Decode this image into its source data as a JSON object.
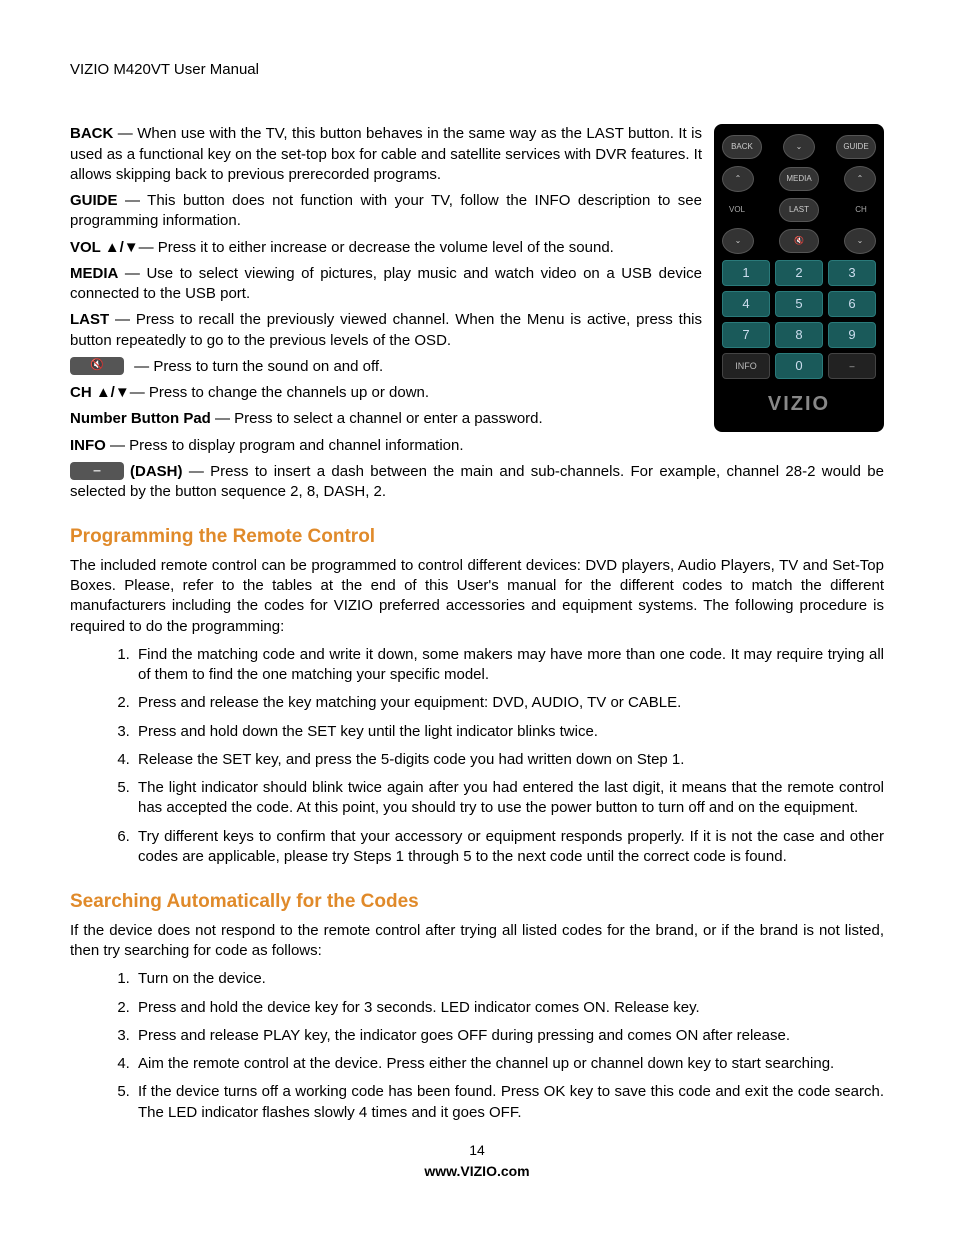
{
  "header": "VIZIO M420VT User Manual",
  "definitions": [
    {
      "key": "BACK",
      "text": " — When use with the TV, this button behaves in the same way as the LAST button. It is used as a functional key on the set-top box for cable and satellite services with DVR features. It allows skipping back to previous prerecorded programs."
    },
    {
      "key": "GUIDE",
      "text": " — This button does not function with your TV, follow the INFO description to see programming information."
    },
    {
      "key": "VOL ▲/▼",
      "text": "— Press it to either increase or decrease the volume level of the sound."
    },
    {
      "key": "MEDIA",
      "text": " — Use to select viewing of pictures, play music and watch video on a USB device connected to the USB port."
    },
    {
      "key": "LAST",
      "text": " — Press to recall the previously viewed channel. When the Menu is active, press this button repeatedly to go to the previous levels of the OSD."
    }
  ],
  "mute_text": " —  Press to turn the sound on and off.",
  "ch": {
    "key": "CH ▲/▼",
    "text": "— Press to change the channels up or down."
  },
  "numpad": {
    "key": "Number Button Pad",
    "text": " — Press to select a channel or enter a password."
  },
  "info": {
    "key": "INFO",
    "text": " — Press to display program and channel information."
  },
  "dash": {
    "key": "(DASH)",
    "text": " — Press to insert a dash between the main and sub-channels. For example, channel 28-2 would be selected by the button sequence 2, 8, DASH, 2."
  },
  "section1": {
    "title": "Programming the Remote Control",
    "intro": "The included remote control can be programmed to control different devices: DVD players, Audio Players, TV and Set-Top Boxes. Please, refer to the tables at the end of this User's manual for the different codes to match the different manufacturers including the codes for VIZIO preferred accessories and equipment systems. The following procedure is required to do the programming:",
    "steps": [
      "Find the matching code and write it down, some makers may have more than one code. It may require trying all of them to find the one matching your specific model.",
      "Press and release the key matching your equipment: DVD, AUDIO, TV or CABLE.",
      "Press and hold down the SET key until the light indicator blinks twice.",
      "Release the SET key, and press the 5-digits code you had written down on Step 1.",
      "The light indicator should blink twice again after you had entered the last digit, it means that the remote control has accepted the code. At this point, you should try to use the power button to turn off and on the equipment.",
      "Try different keys to confirm that your accessory or equipment responds properly. If it is not the case and other codes are applicable, please try Steps 1 through 5 to the next code until the correct code is found."
    ]
  },
  "section2": {
    "title": "Searching Automatically for the Codes",
    "intro": "If the device does not respond to the remote control after trying all listed codes for the brand, or if the brand is not listed, then try searching for code as follows:",
    "steps": [
      "Turn on the device.",
      "Press and hold the device key for 3 seconds. LED indicator comes ON. Release key.",
      "Press and release PLAY key, the indicator goes OFF during pressing and comes ON after release.",
      "Aim the remote control at the device. Press either the channel up or channel down key to start searching.",
      "If the device turns off a working code has been found. Press OK key to save this code and exit the code search. The LED indicator flashes slowly 4 times and it goes OFF."
    ]
  },
  "remote": {
    "back": "BACK",
    "guide": "GUIDE",
    "media": "MEDIA",
    "last": "LAST",
    "vol": "VOL",
    "ch": "CH",
    "info": "INFO",
    "keys": [
      "1",
      "2",
      "3",
      "4",
      "5",
      "6",
      "7",
      "8",
      "9"
    ],
    "zero": "0",
    "dash": "–",
    "logo": "VIZIO"
  },
  "footer": {
    "page": "14",
    "url": "www.VIZIO.com"
  }
}
